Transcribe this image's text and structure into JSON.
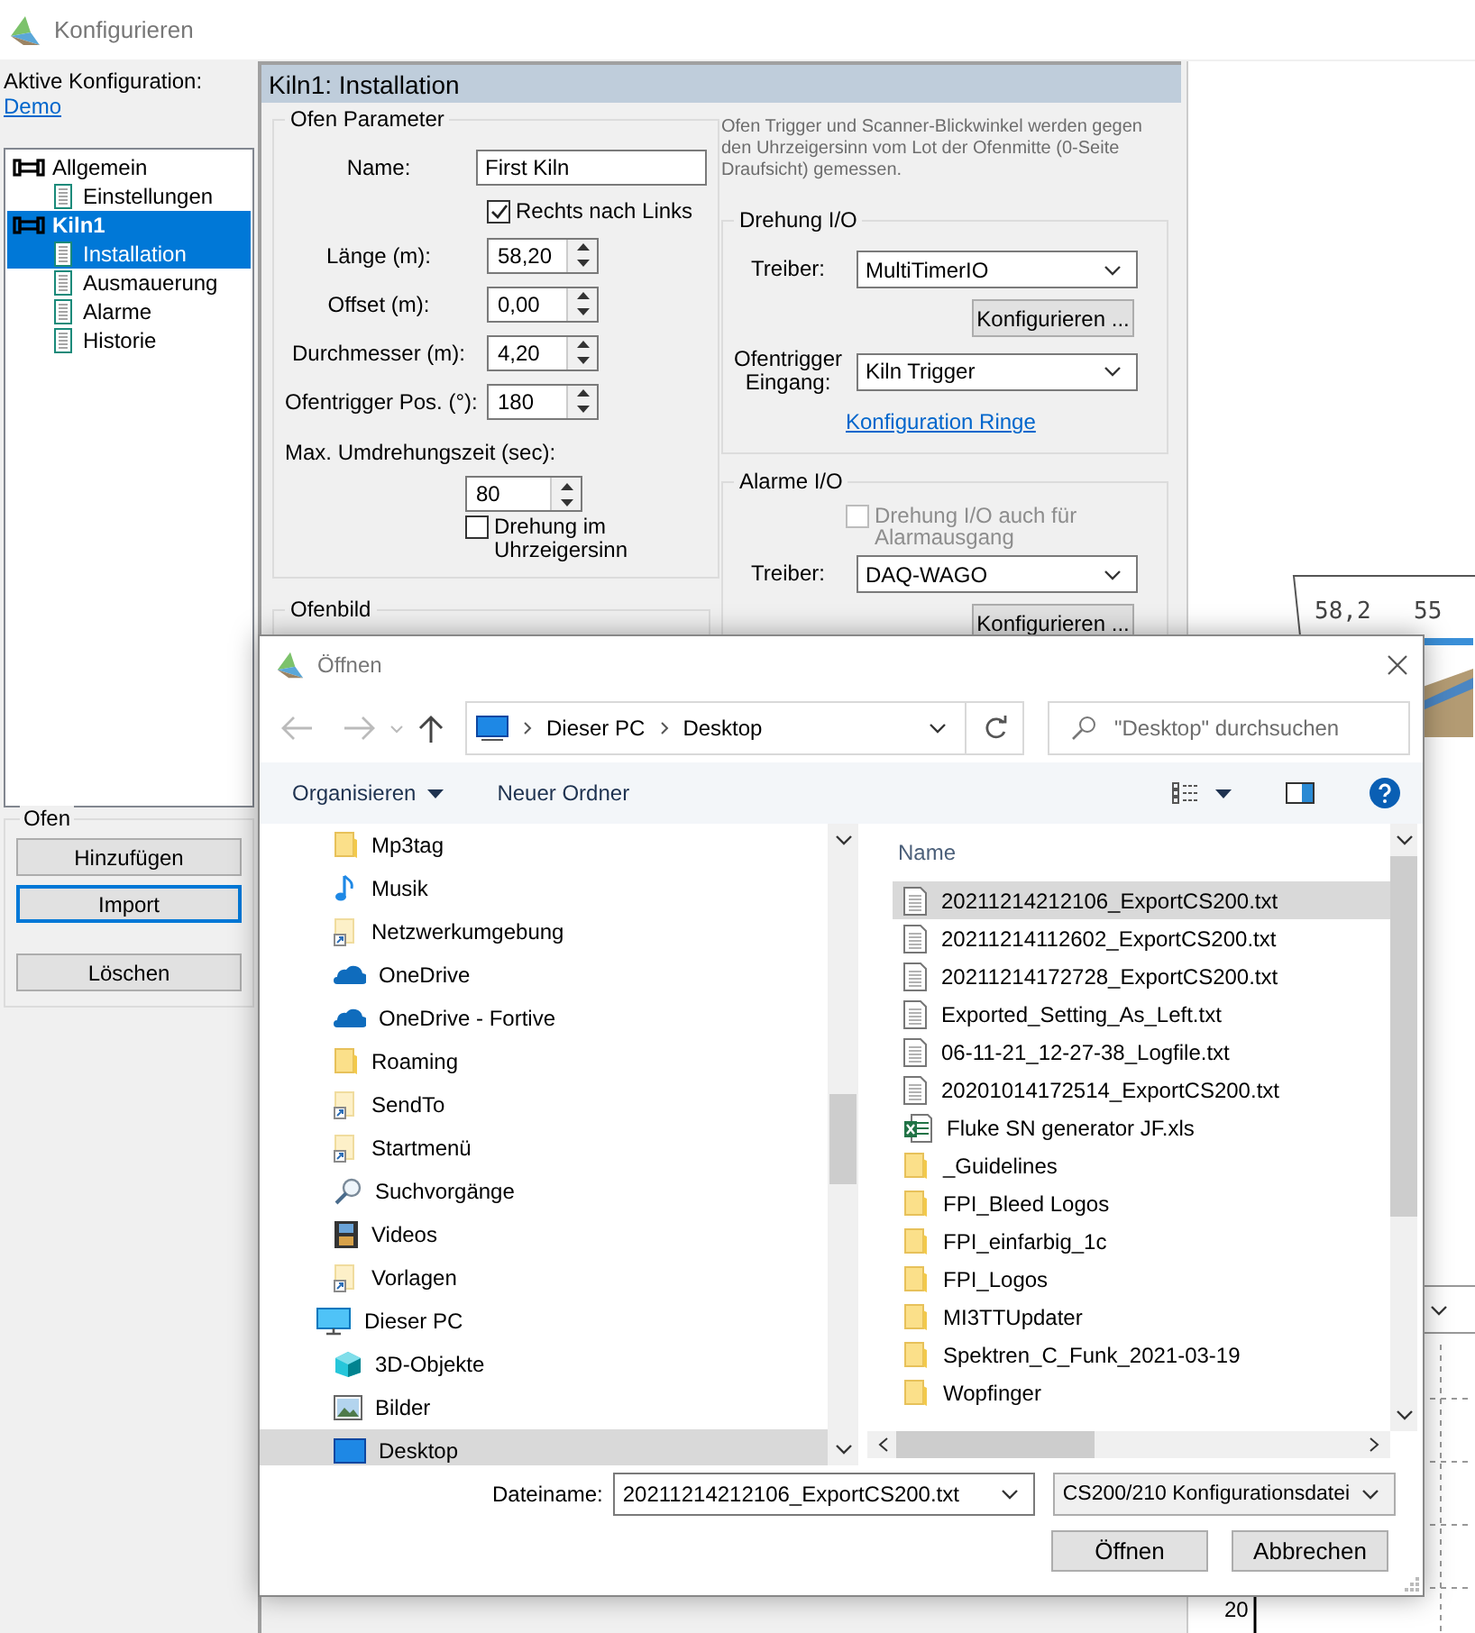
{
  "window": {
    "title": "Konfigurieren"
  },
  "sidebar": {
    "active_label": "Aktive Konfiguration:",
    "active_link": "Demo",
    "tree": [
      {
        "label": "Allgemein",
        "kind": "kiln",
        "selected": false,
        "children": [
          {
            "label": "Einstellungen",
            "kind": "page",
            "selected": false
          }
        ]
      },
      {
        "label": "Kiln1",
        "kind": "kiln",
        "selected": true,
        "children": [
          {
            "label": "Installation",
            "kind": "page",
            "selected": true
          },
          {
            "label": "Ausmauerung",
            "kind": "page",
            "selected": false
          },
          {
            "label": "Alarme",
            "kind": "page",
            "selected": false
          },
          {
            "label": "Historie",
            "kind": "page",
            "selected": false
          }
        ]
      }
    ],
    "group": {
      "title": "Ofen",
      "buttons": [
        {
          "label": "Hinzufügen",
          "focused": false
        },
        {
          "label": "Import",
          "focused": true
        },
        {
          "label": "Löschen",
          "focused": false
        }
      ]
    }
  },
  "panel": {
    "title": "Kiln1: Installation",
    "ofen_parameter": {
      "title": "Ofen Parameter",
      "name_label": "Name:",
      "name_value": "First Kiln",
      "direction": {
        "label": "Rechts nach Links",
        "checked": true
      },
      "spinners": [
        {
          "label": "Länge (m):",
          "value": "58,20"
        },
        {
          "label": "Offset (m):",
          "value": "0,00"
        },
        {
          "label": "Durchmesser (m):",
          "value": "4,20"
        },
        {
          "label": "Ofentrigger Pos. (°):",
          "value": "180"
        }
      ],
      "max_label": "Max. Umdrehungszeit (sec):",
      "max_value": "80",
      "clockwise": {
        "label": "Drehung im Uhrzeigersinn",
        "checked": false
      }
    },
    "ofenbild": {
      "title": "Ofenbild"
    },
    "note": "Ofen Trigger und Scanner-Blickwinkel werden gegen den Uhrzeigersinn vom Lot der Ofenmitte (0-Seite Draufsicht) gemessen.",
    "drehung_io": {
      "title": "Drehung I/O",
      "driver_label": "Treiber:",
      "driver": "MultiTimerIO",
      "configure": "Konfigurieren ...",
      "trigger_label": "Ofentrigger Eingang:",
      "trigger": "Kiln Trigger",
      "link": "Konfiguration Ringe"
    },
    "alarme_io": {
      "title": "Alarme I/O",
      "share": {
        "label": "Drehung I/O auch für Alarmausgang",
        "checked": false,
        "disabled": true
      },
      "driver_label": "Treiber:",
      "driver": "DAQ-WAGO",
      "configure": "Konfigurieren ..."
    }
  },
  "canvas": {
    "ruler": [
      "58,2",
      "55"
    ],
    "axis_label": "20"
  },
  "dialog": {
    "title": "Öffnen",
    "breadcrumb": [
      "Dieser PC",
      "Desktop"
    ],
    "search_placeholder": "\"Desktop\" durchsuchen",
    "toolbar": {
      "organize": "Organisieren",
      "new_folder": "Neuer Ordner"
    },
    "nav_items": [
      {
        "label": "Mp3tag",
        "kind": "folder",
        "selected": false
      },
      {
        "label": "Musik",
        "kind": "music",
        "selected": false
      },
      {
        "label": "Netzwerkumgebung",
        "kind": "shortcut",
        "selected": false
      },
      {
        "label": "OneDrive",
        "kind": "cloud",
        "selected": false
      },
      {
        "label": "OneDrive - Fortive",
        "kind": "cloud",
        "selected": false
      },
      {
        "label": "Roaming",
        "kind": "folder",
        "selected": false
      },
      {
        "label": "SendTo",
        "kind": "shortcut",
        "selected": false
      },
      {
        "label": "Startmenü",
        "kind": "shortcut",
        "selected": false
      },
      {
        "label": "Suchvorgänge",
        "kind": "search",
        "selected": false
      },
      {
        "label": "Videos",
        "kind": "video",
        "selected": false
      },
      {
        "label": "Vorlagen",
        "kind": "shortcut",
        "selected": false
      }
    ],
    "nav_tree": [
      {
        "label": "Dieser PC",
        "kind": "pc",
        "selected": false,
        "children": [
          {
            "label": "3D-Objekte",
            "kind": "objects3d",
            "selected": false
          },
          {
            "label": "Bilder",
            "kind": "pictures",
            "selected": false
          },
          {
            "label": "Desktop",
            "kind": "desktop",
            "selected": true
          }
        ]
      }
    ],
    "files": {
      "column": "Name",
      "rows": [
        {
          "name": "20211214212106_ExportCS200.txt",
          "kind": "txt",
          "selected": true
        },
        {
          "name": "20211214112602_ExportCS200.txt",
          "kind": "txt",
          "selected": false
        },
        {
          "name": "20211214172728_ExportCS200.txt",
          "kind": "txt",
          "selected": false
        },
        {
          "name": "Exported_Setting_As_Left.txt",
          "kind": "txt",
          "selected": false
        },
        {
          "name": "06-11-21_12-27-38_Logfile.txt",
          "kind": "txt",
          "selected": false
        },
        {
          "name": "20201014172514_ExportCS200.txt",
          "kind": "txt",
          "selected": false
        },
        {
          "name": "Fluke SN generator JF.xls",
          "kind": "xls",
          "selected": false
        },
        {
          "name": "_Guidelines",
          "kind": "folder",
          "selected": false
        },
        {
          "name": "FPI_Bleed Logos",
          "kind": "folder",
          "selected": false
        },
        {
          "name": "FPI_einfarbig_1c",
          "kind": "folder",
          "selected": false
        },
        {
          "name": "FPI_Logos",
          "kind": "folder",
          "selected": false
        },
        {
          "name": "MI3TTUpdater",
          "kind": "folder",
          "selected": false
        },
        {
          "name": "Spektren_C_Funk_2021-03-19",
          "kind": "folder",
          "selected": false
        },
        {
          "name": "Wopfinger",
          "kind": "folder",
          "selected": false
        }
      ]
    },
    "filename_label": "Dateiname:",
    "filename": "20211214212106_ExportCS200.txt",
    "filetype": "CS200/210 Konfigurationsdatei",
    "buttons": [
      "Öffnen",
      "Abbrechen"
    ]
  }
}
